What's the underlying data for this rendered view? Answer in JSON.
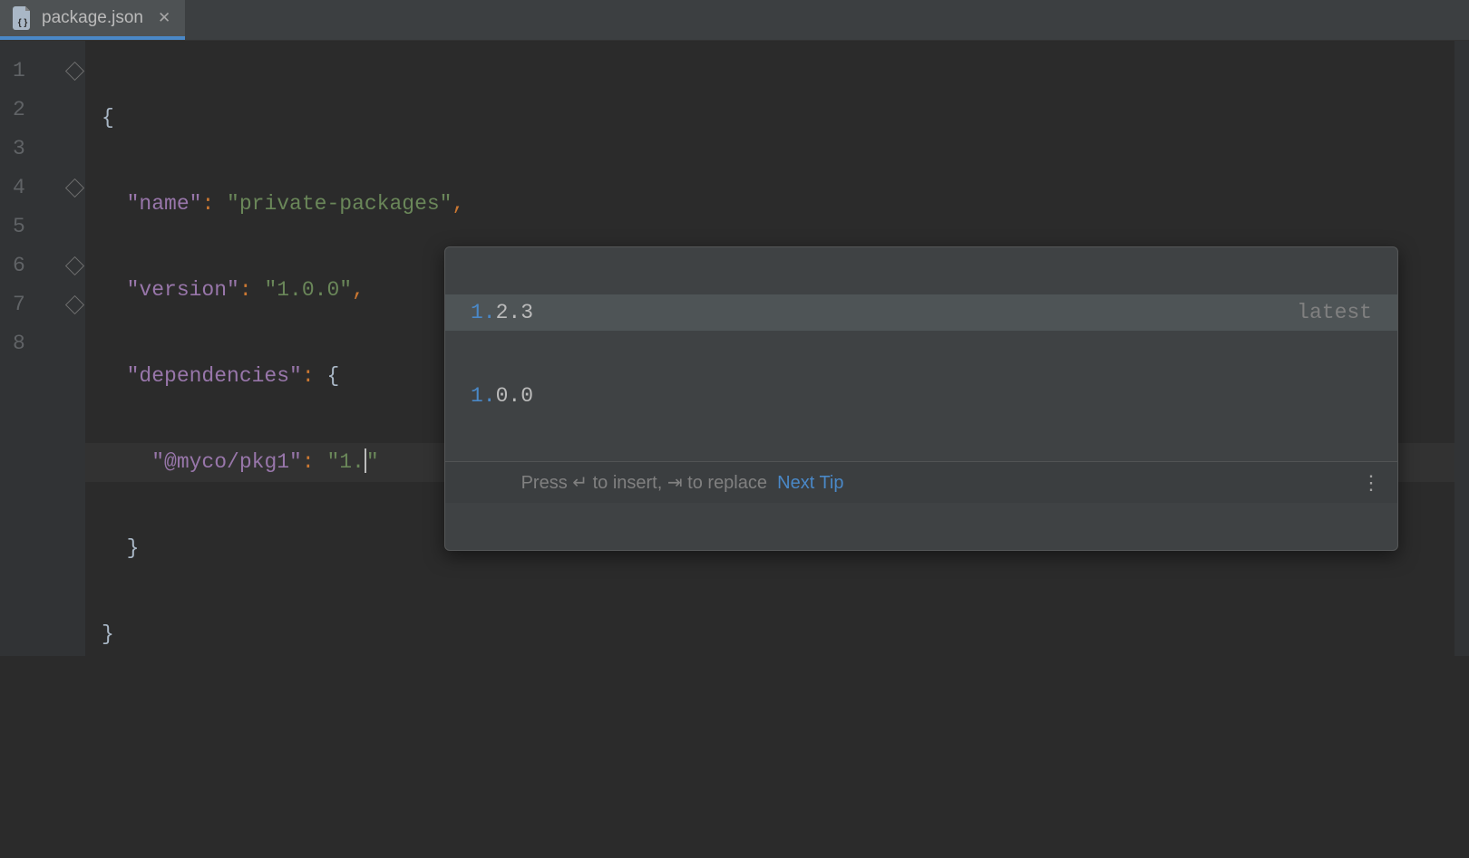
{
  "tab": {
    "filename": "package.json"
  },
  "gutter": {
    "lines": [
      "1",
      "2",
      "3",
      "4",
      "5",
      "6",
      "7",
      "8"
    ]
  },
  "code": {
    "l1": "{",
    "l2": {
      "key": "\"name\"",
      "colon": ": ",
      "val": "\"private-packages\"",
      "trail": ","
    },
    "l3": {
      "key": "\"version\"",
      "colon": ": ",
      "val": "\"1.0.0\"",
      "trail": ","
    },
    "l4": {
      "key": "\"dependencies\"",
      "colon": ": ",
      "brace": "{"
    },
    "l5": {
      "key": "\"@myco/pkg1\"",
      "colon": ": ",
      "q1": "\"",
      "typed": "1.",
      "q2": "\""
    },
    "l6": "}",
    "l7": "}"
  },
  "popup": {
    "items": [
      {
        "match": "1.",
        "rest": "2.3",
        "tail": "latest"
      },
      {
        "match": "1.",
        "rest": "0.0",
        "tail": ""
      }
    ],
    "hint_pre": "Press ",
    "hint_mid1": " to insert, ",
    "hint_mid2": " to replace",
    "next_tip": "Next Tip"
  }
}
